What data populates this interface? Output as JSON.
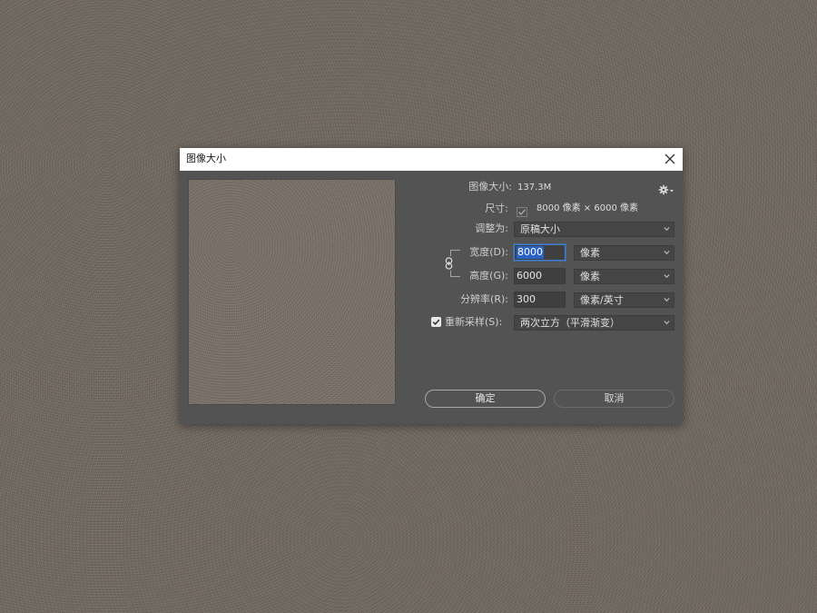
{
  "dialog": {
    "title": "图像大小",
    "close_icon": "close-icon"
  },
  "info": {
    "image_size_label": "图像大小:",
    "image_size_value": "137.3M",
    "dimensions_label": "尺寸:",
    "dimensions_value": "8000 像素 × 6000 像素",
    "gear_icon": "gear-icon"
  },
  "fit_to": {
    "label": "调整为:",
    "value": "原稿大小"
  },
  "width": {
    "label": "宽度(D):",
    "value": "8000",
    "unit": "像素"
  },
  "height": {
    "label": "高度(G):",
    "value": "6000",
    "unit": "像素"
  },
  "resolution": {
    "label": "分辨率(R):",
    "value": "300",
    "unit": "像素/英寸"
  },
  "resample": {
    "label": "重新采样(S):",
    "checked": true,
    "value": "两次立方（平滑渐变）"
  },
  "buttons": {
    "ok": "确定",
    "cancel": "取消"
  },
  "colors": {
    "dialog_bg": "#535353",
    "accent": "#2a62c6"
  }
}
